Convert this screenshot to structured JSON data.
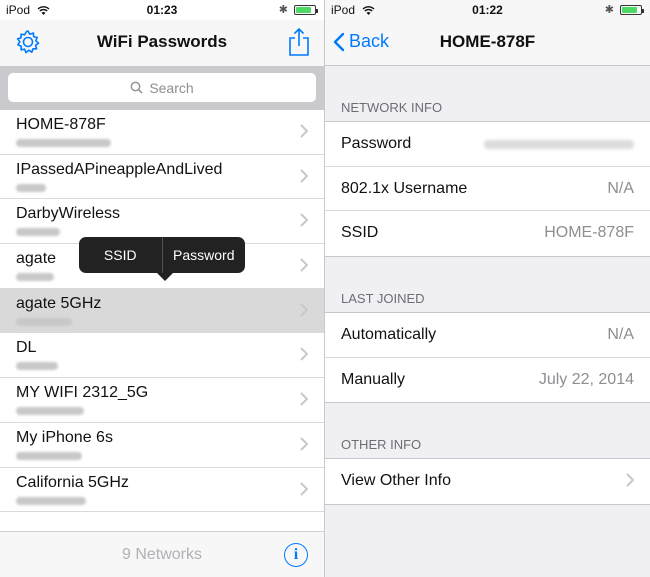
{
  "left": {
    "status": {
      "carrier": "iPod",
      "time": "01:23",
      "battery_level": 0.85
    },
    "nav": {
      "title": "WiFi Passwords",
      "left_icon": "gear-icon",
      "right_icon": "share-icon"
    },
    "search": {
      "placeholder": "Search"
    },
    "networks": [
      {
        "name": "HOME-878F"
      },
      {
        "name": "IPassedAPineappleAndLived"
      },
      {
        "name": "DarbyWireless"
      },
      {
        "name": "agate"
      },
      {
        "name": "agate 5GHz"
      },
      {
        "name": "DL"
      },
      {
        "name": "MY WIFI 2312_5G"
      },
      {
        "name": "My iPhone 6s"
      },
      {
        "name": "California 5GHz"
      }
    ],
    "popup": {
      "ssid_label": "SSID",
      "password_label": "Password"
    },
    "toolbar": {
      "count": "9 Networks",
      "info_icon": "info-icon"
    }
  },
  "right": {
    "status": {
      "carrier": "iPod",
      "time": "01:22",
      "battery_level": 0.85
    },
    "nav": {
      "back_label": "Back",
      "title": "HOME-878F"
    },
    "sections": [
      {
        "header": "NETWORK INFO",
        "rows": [
          {
            "label": "Password",
            "value": ""
          },
          {
            "label": "802.1x Username",
            "value": "N/A"
          },
          {
            "label": "SSID",
            "value": "HOME-878F"
          }
        ]
      },
      {
        "header": "LAST JOINED",
        "rows": [
          {
            "label": "Automatically",
            "value": "N/A"
          },
          {
            "label": "Manually",
            "value": "July 22, 2014"
          }
        ]
      },
      {
        "header": "OTHER INFO",
        "rows": [
          {
            "label": "View Other Info",
            "value": ""
          }
        ]
      }
    ]
  },
  "colors": {
    "accent": "#007aff",
    "battery": "#4cd964",
    "popup": "#222222"
  }
}
